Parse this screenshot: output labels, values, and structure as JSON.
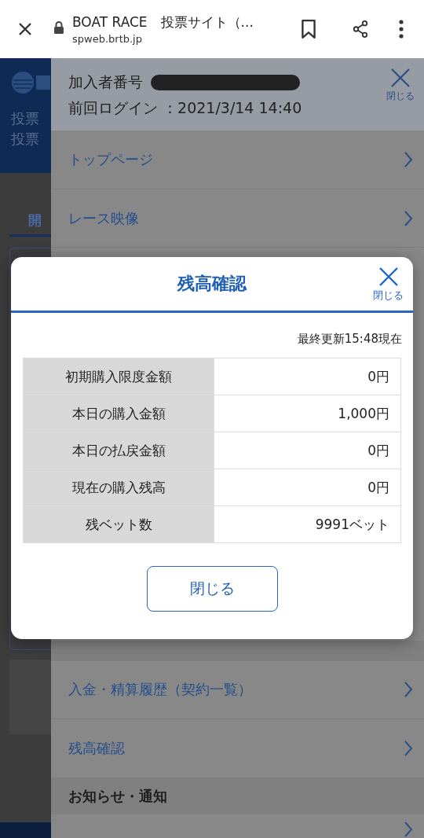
{
  "browser": {
    "title": "BOAT RACE　投票サイト（...",
    "url": "spweb.brtb.jp"
  },
  "background_page": {
    "header_lines": [
      "投票",
      "投票"
    ],
    "tab": "開"
  },
  "menu": {
    "member_label": "加入者番号",
    "last_login": "前回ログイン ：2021/3/14 14:40",
    "close_label": "閉じる",
    "sections": [
      {
        "items": [
          "トップページ",
          "レース映像"
        ]
      },
      {
        "items": [
          "入金・精算履歴（契約一覧）",
          "残高確認"
        ]
      },
      {
        "heading": "お知らせ・通知"
      }
    ]
  },
  "dialog": {
    "title": "残高確認",
    "close_label": "閉じる",
    "updated": "最終更新15:48現在",
    "rows": [
      {
        "label": "初期購入限度金額",
        "value": "0円"
      },
      {
        "label": "本日の購入金額",
        "value": "1,000円"
      },
      {
        "label": "本日の払戻金額",
        "value": "0円"
      },
      {
        "label": "現在の購入残高",
        "value": "0円"
      },
      {
        "label": "残ベット数",
        "value": "9991ベット"
      }
    ],
    "button": "閉じる"
  }
}
